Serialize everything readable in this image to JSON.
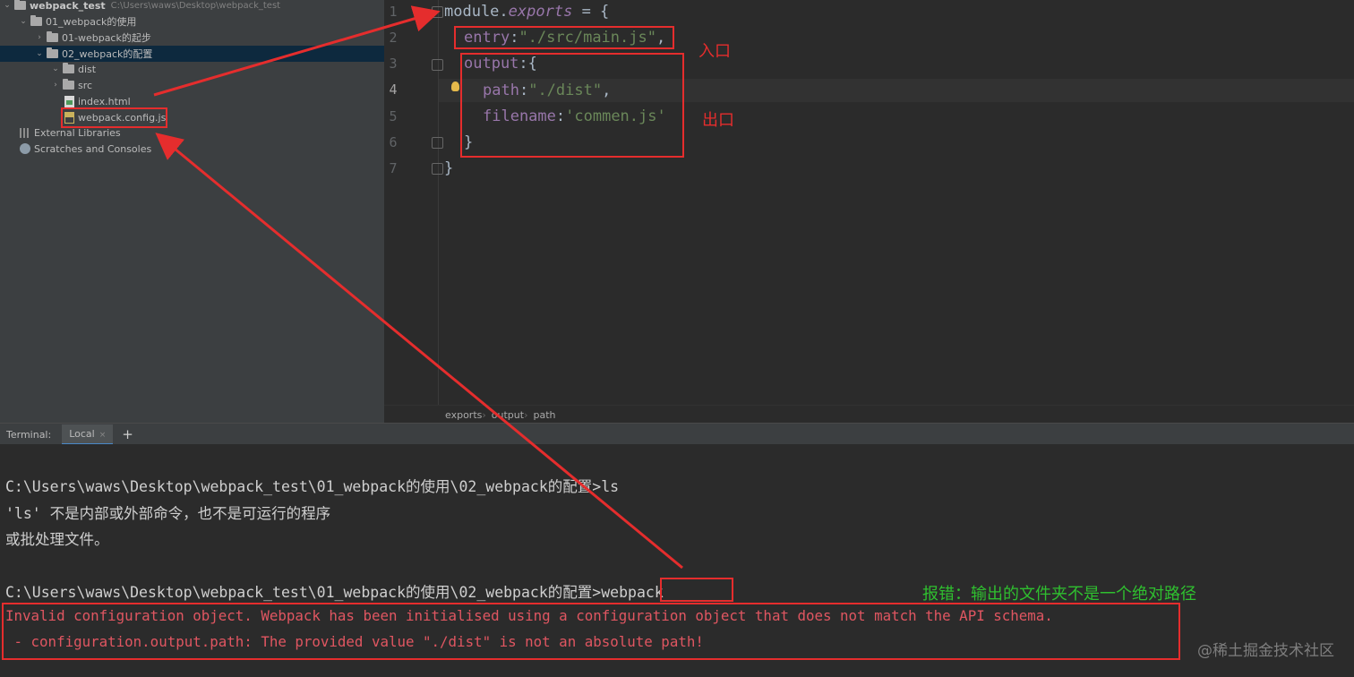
{
  "project_tree": {
    "root_name": "webpack_test",
    "root_path": "C:\\Users\\waws\\Desktop\\webpack_test",
    "items": [
      {
        "label": "01_webpack的使用"
      },
      {
        "label": "01-webpack的起步"
      },
      {
        "label": "02_webpack的配置"
      },
      {
        "label": "dist"
      },
      {
        "label": "src"
      },
      {
        "label": "index.html"
      },
      {
        "label": "webpack.config.js"
      },
      {
        "label": "External Libraries"
      },
      {
        "label": "Scratches and Consoles"
      }
    ]
  },
  "editor": {
    "line_numbers": [
      "1",
      "2",
      "3",
      "4",
      "5",
      "6",
      "7"
    ],
    "code": {
      "l1_module": "module",
      "l1_dot": ".",
      "l1_exports": "exports",
      "l1_rest": " = {",
      "l2_key": "entry",
      "l2_colon": ":",
      "l2_value": "\"./src/main.js\"",
      "l2_comma": ",",
      "l3_key": "output",
      "l3_rest": ":{",
      "l4_key": "path",
      "l4_colon": ":",
      "l4_value": "\"./dist\"",
      "l4_comma": ",",
      "l5_key": "filename",
      "l5_colon": ":",
      "l5_value": "'commen.js'",
      "l6": "}",
      "l7": "}"
    },
    "breadcrumbs": [
      "exports",
      "output",
      "path"
    ]
  },
  "terminal": {
    "tab_title": "Terminal:",
    "tab_local": "Local",
    "tab_close": "×",
    "add_tab": "+",
    "lines": [
      "C:\\Users\\waws\\Desktop\\webpack_test\\01_webpack的使用\\02_webpack的配置>ls",
      "'ls' 不是内部或外部命令，也不是可运行的程序",
      "或批处理文件。",
      "C:\\Users\\waws\\Desktop\\webpack_test\\01_webpack的使用\\02_webpack的配置>webpack",
      "Invalid configuration object. Webpack has been initialised using a configuration object that does not match the API schema.",
      " - configuration.output.path: The provided value \"./dist\" is not an absolute path!"
    ]
  },
  "annotations": {
    "entry_label": "入口",
    "output_label": "出口",
    "error_note": "报错：输出的文件夹不是一个绝对路径",
    "watermark": "@稀土掘金技术社区"
  },
  "colors": {
    "annotation_red": "#e52d2d",
    "annotation_green": "#2fbf2f",
    "error_text": "#e05661"
  }
}
